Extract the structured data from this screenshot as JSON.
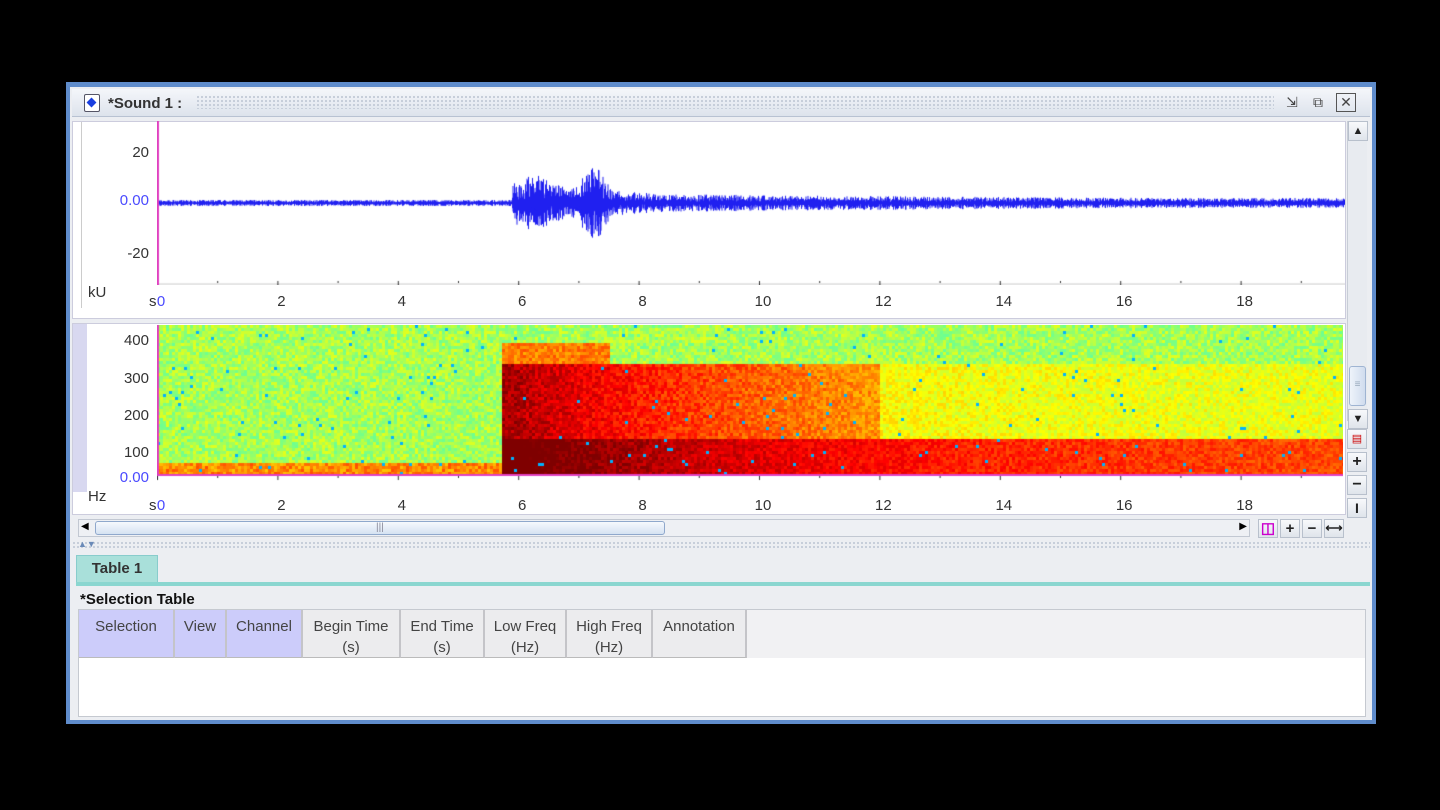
{
  "window": {
    "title": "*Sound 1 :",
    "buttons": [
      "minimize",
      "maximize",
      "close"
    ]
  },
  "waveform": {
    "y_unit": "kU",
    "x_unit": "s",
    "y_ticks": [
      "20",
      "0.00",
      "-20"
    ],
    "x_ticks": [
      "0",
      "2",
      "4",
      "6",
      "8",
      "10",
      "12",
      "14",
      "16",
      "18"
    ],
    "color": "#2020f0"
  },
  "spectrogram": {
    "y_unit": "Hz",
    "x_unit": "s",
    "y_ticks": [
      "400",
      "300",
      "200",
      "100",
      "0.00"
    ],
    "x_ticks": [
      "0",
      "2",
      "4",
      "6",
      "8",
      "10",
      "12",
      "14",
      "16",
      "18"
    ],
    "colormap": "jet"
  },
  "zoom_tools": {
    "vertical": [
      "fit-icon",
      "plus-icon",
      "minus-icon",
      "full-icon"
    ],
    "horizontal": [
      "fit-icon",
      "plus-icon",
      "minus-icon",
      "full-icon"
    ]
  },
  "tabs": [
    {
      "label": "Table 1"
    }
  ],
  "selection_table": {
    "title": "*Selection Table",
    "columns": [
      {
        "l1": "Selection",
        "l2": ""
      },
      {
        "l1": "View",
        "l2": ""
      },
      {
        "l1": "Channel",
        "l2": ""
      },
      {
        "l1": "Begin Time",
        "l2": "(s)"
      },
      {
        "l1": "End Time",
        "l2": "(s)"
      },
      {
        "l1": "Low Freq",
        "l2": "(Hz)"
      },
      {
        "l1": "High Freq",
        "l2": "(Hz)"
      },
      {
        "l1": "Annotation",
        "l2": ""
      }
    ],
    "rows": []
  }
}
